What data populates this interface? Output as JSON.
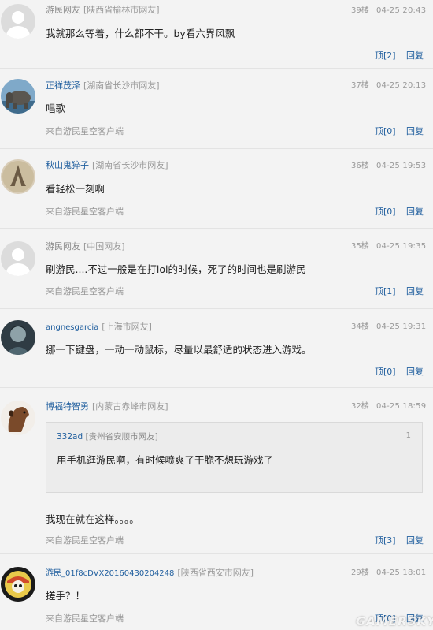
{
  "comments": [
    {
      "user": "游民网友",
      "location": "[陕西省榆林市网友]",
      "floor": "39楼",
      "time": "04-25 20:43",
      "text": "我就那么等着，什么都不干。by看六界风飘",
      "up": "顶[2]",
      "reply": "回复",
      "source": ""
    },
    {
      "user": "正祥茂泽",
      "location": "[湖南省长沙市网友]",
      "floor": "37楼",
      "time": "04-25 20:13",
      "text": "唱歌",
      "up": "顶[0]",
      "reply": "回复",
      "source": "来自游民星空客户端"
    },
    {
      "user": "秋山鬼猝子",
      "location": "[湖南省长沙市网友]",
      "floor": "36楼",
      "time": "04-25 19:53",
      "text": "看轻松一刻啊",
      "up": "顶[0]",
      "reply": "回复",
      "source": "来自游民星空客户端"
    },
    {
      "user": "游民网友",
      "location": "[中国网友]",
      "floor": "35楼",
      "time": "04-25 19:35",
      "text": "刷游民....不过一般是在打lol的时候，死了的时间也是刷游民",
      "up": "顶[1]",
      "reply": "回复",
      "source": "来自游民星空客户端"
    },
    {
      "user": "angnesgarcia",
      "location": "[上海市网友]",
      "floor": "34楼",
      "time": "04-25 19:31",
      "text": "挪一下键盘，一动一动鼠标，尽量以最舒适的状态进入游戏。",
      "up": "顶[0]",
      "reply": "回复",
      "source": ""
    },
    {
      "user": "博福特智勇",
      "location": "[内蒙古赤峰市网友]",
      "floor": "32楼",
      "time": "04-25 18:59",
      "quote": {
        "user": "332ad",
        "location": "[贵州省安顺市网友]",
        "num": "1",
        "text": "用手机逛游民啊，有时候喷爽了干脆不想玩游戏了"
      },
      "text": "我现在就在这样。。。。",
      "up": "顶[3]",
      "reply": "回复",
      "source": "来自游民星空客户端"
    },
    {
      "user": "游民_01f8cDVX20160430204248",
      "location": "[陕西省西安市网友]",
      "floor": "29楼",
      "time": "04-25 18:01",
      "text": "搓手？！",
      "up": "顶[0]",
      "reply": "回复",
      "source": "来自游民星空客户端"
    }
  ],
  "watermark": "GAMERSKY"
}
